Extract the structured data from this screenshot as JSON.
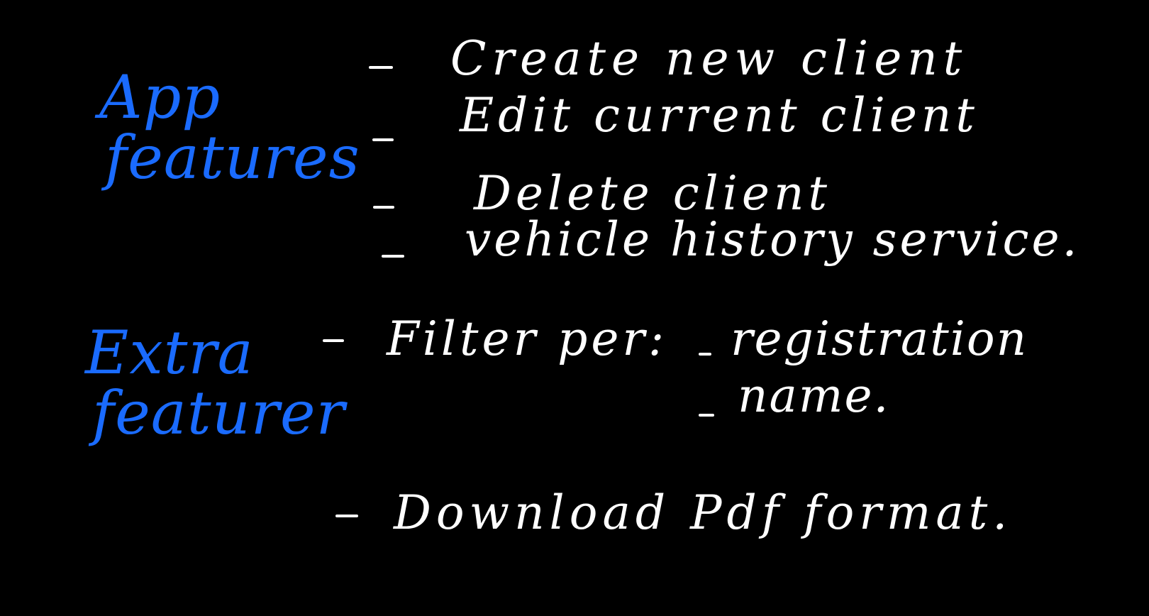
{
  "colors": {
    "background": "#000000",
    "heading_ink": "#1a6bff",
    "item_ink": "#ffffff"
  },
  "sections": [
    {
      "heading": [
        "App",
        "features"
      ],
      "items": [
        "Create new client",
        "Edit current client",
        "Delete client",
        "vehicle history service."
      ]
    },
    {
      "heading": [
        "Extra",
        "featurer"
      ],
      "items": [
        "Filter per:",
        "Download Pdf format."
      ],
      "subitems": [
        "registration",
        "name."
      ]
    }
  ]
}
